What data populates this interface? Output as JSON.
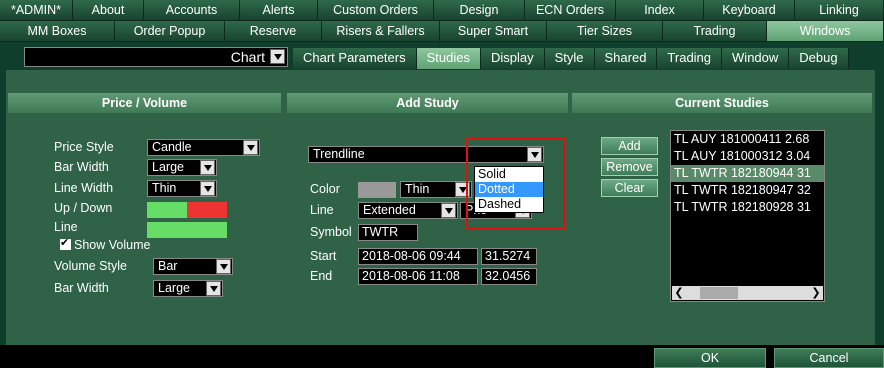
{
  "tabs_row1": [
    "*ADMIN*",
    "About",
    "Accounts",
    "Alerts",
    "Custom Orders",
    "Design",
    "ECN Orders",
    "Index",
    "Keyboard",
    "Linking"
  ],
  "tabs_row2": [
    "MM Boxes",
    "Order Popup",
    "Reserve",
    "Risers & Fallers",
    "Super Smart",
    "Tier Sizes",
    "Trading",
    "Windows"
  ],
  "chart_selector": "Chart",
  "subtabs": [
    "Chart Parameters",
    "Studies",
    "Display",
    "Style",
    "Shared",
    "Trading",
    "Window",
    "Debug"
  ],
  "price_volume": {
    "header": "Price / Volume",
    "price_style_label": "Price Style",
    "price_style": "Candle",
    "bar_width_label": "Bar Width",
    "bar_width": "Large",
    "line_width_label": "Line Width",
    "line_width": "Thin",
    "up_down_label": "Up / Down",
    "line_label": "Line",
    "show_volume_label": "Show Volume",
    "volume_style_label": "Volume Style",
    "volume_style": "Bar",
    "bar_width2_label": "Bar Width",
    "bar_width2": "Large",
    "colors": {
      "up": "#66dd66",
      "down": "#ee3333",
      "line": "#66dd66",
      "study": "#999999"
    }
  },
  "add_study": {
    "header": "Add Study",
    "study_type": "Trendline",
    "color_label": "Color",
    "thickness": "Thin",
    "line_label": "Line",
    "line_value": "Extended",
    "price_partial": "Pric",
    "symbol_label": "Symbol",
    "symbol": "TWTR",
    "start_label": "Start",
    "start_time": "2018-08-06 09:44",
    "start_price": "31.5274",
    "end_label": "End",
    "end_time": "2018-08-06 11:08",
    "end_price": "32.0456",
    "dropdown_options": [
      "Solid",
      "Dotted",
      "Dashed"
    ],
    "dropdown_selected": "Dotted"
  },
  "current_studies": {
    "header": "Current Studies",
    "add_label": "Add",
    "remove_label": "Remove",
    "clear_label": "Clear",
    "items": [
      "TL AUY 181000411 2.68",
      "TL AUY 181000312 3.04",
      "TL TWTR 182180944 31",
      "TL TWTR 182180947 32",
      "TL TWTR 182180928 31"
    ]
  },
  "footer": {
    "ok_label": "OK",
    "cancel_label": "Cancel"
  }
}
